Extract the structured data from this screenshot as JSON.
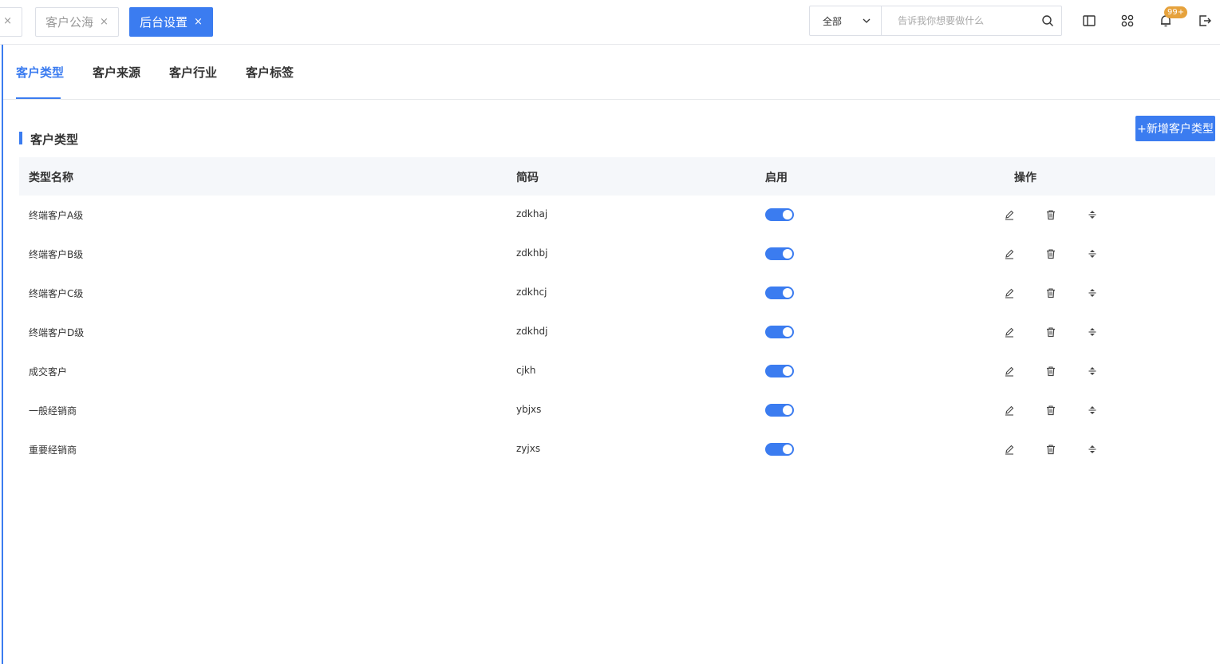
{
  "topbar": {
    "tabs": [
      {
        "label": "客户公海"
      },
      {
        "label": "后台设置"
      }
    ],
    "close_glyph": "×",
    "search": {
      "select_value": "全部",
      "placeholder": "告诉我你想要做什么"
    },
    "icons": [
      "sidebar-toggle-icon",
      "apps-grid-icon",
      "bell-icon",
      "logout-icon"
    ],
    "notification_badge": "99+"
  },
  "subtabs": [
    "客户类型",
    "客户来源",
    "客户行业",
    "客户标签"
  ],
  "section": {
    "title": "客户类型",
    "add_button": "+新增客户类型"
  },
  "table": {
    "columns": [
      "类型名称",
      "简码",
      "启用",
      "操作"
    ],
    "rows": [
      {
        "name": "终端客户A级",
        "code": "zdkhaj",
        "enabled": true
      },
      {
        "name": "终端客户B级",
        "code": "zdkhbj",
        "enabled": true
      },
      {
        "name": "终端客户C级",
        "code": "zdkhcj",
        "enabled": true
      },
      {
        "name": "终端客户D级",
        "code": "zdkhdj",
        "enabled": true
      },
      {
        "name": "成交客户",
        "code": "cjkh",
        "enabled": true
      },
      {
        "name": "一般经销商",
        "code": "ybjxs",
        "enabled": true
      },
      {
        "name": "重要经销商",
        "code": "zyjxs",
        "enabled": true
      }
    ]
  },
  "colors": {
    "accent": "#3b7cf0",
    "badge": "#e6a23c",
    "header_bg": "#f5f7fa"
  }
}
